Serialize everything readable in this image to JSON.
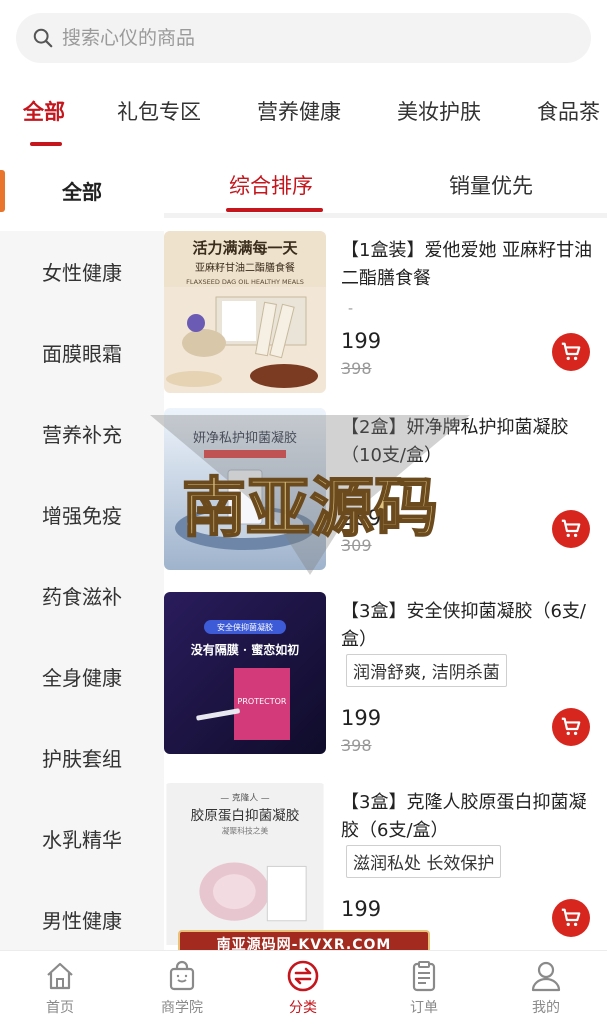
{
  "search": {
    "placeholder": "搜索心仪的商品"
  },
  "top_tabs": [
    {
      "label": "全部",
      "active": true
    },
    {
      "label": "礼包专区"
    },
    {
      "label": "营养健康"
    },
    {
      "label": "美妆护肤"
    },
    {
      "label": "食品茶"
    }
  ],
  "sidebar": {
    "items": [
      {
        "label": "全部",
        "active": true
      },
      {
        "label": "女性健康"
      },
      {
        "label": "面膜眼霜"
      },
      {
        "label": "营养补充"
      },
      {
        "label": "增强免疫"
      },
      {
        "label": "药食滋补"
      },
      {
        "label": "全身健康"
      },
      {
        "label": "护肤套组"
      },
      {
        "label": "水乳精华"
      },
      {
        "label": "男性健康"
      }
    ]
  },
  "sort_tabs": [
    {
      "label": "综合排序",
      "active": true
    },
    {
      "label": "销量优先"
    }
  ],
  "products": [
    {
      "title": "【1盒装】爱他爱她 亚麻籽甘油二酯膳食餐",
      "tag": "",
      "dash": "-",
      "price": "199",
      "old_price": "398",
      "image_text": {
        "line1": "活力满满每一天",
        "line2": "亚麻籽甘油二酯膳食餐",
        "line3": "FLAXSEED DAG OIL HEALTHY MEALS"
      }
    },
    {
      "title": "【2盒】妍净牌私护抑菌凝胶（10支/盒）",
      "tag": "",
      "price": "289",
      "old_price": "309",
      "image_text": {
        "line1": "妍净私护抑菌凝胶"
      }
    },
    {
      "title": "【3盒】安全侠抑菌凝胶（6支/盒）",
      "tag": "润滑舒爽, 洁阴杀菌",
      "price": "199",
      "old_price": "398",
      "image_text": {
        "line1": "安全侠抑菌凝胶",
        "line2": "没有隔膜 · 蜜恋如初",
        "line3": "PROTECTOR"
      }
    },
    {
      "title": "【3盒】克隆人胶原蛋白抑菌凝胶（6支/盒）",
      "tag": "滋润私处 长效保护",
      "price": "199",
      "old_price": "",
      "image_text": {
        "line1": "— 克隆人 —",
        "line2": "胶原蛋白抑菌凝胶",
        "line3": "凝聚科技之美"
      }
    }
  ],
  "bottom_nav": [
    {
      "label": "首页",
      "icon": "home-icon"
    },
    {
      "label": "商学院",
      "icon": "shopping-bag-icon"
    },
    {
      "label": "分类",
      "icon": "category-icon",
      "active": true
    },
    {
      "label": "订单",
      "icon": "order-icon"
    },
    {
      "label": "我的",
      "icon": "user-icon"
    }
  ],
  "watermark": {
    "text": "南亚源码",
    "banner": "南亚源码网-KVXR.COM"
  },
  "colors": {
    "accent": "#c4161c",
    "sidebar_indicator": "#e8752b",
    "cart": "#d7261e"
  }
}
